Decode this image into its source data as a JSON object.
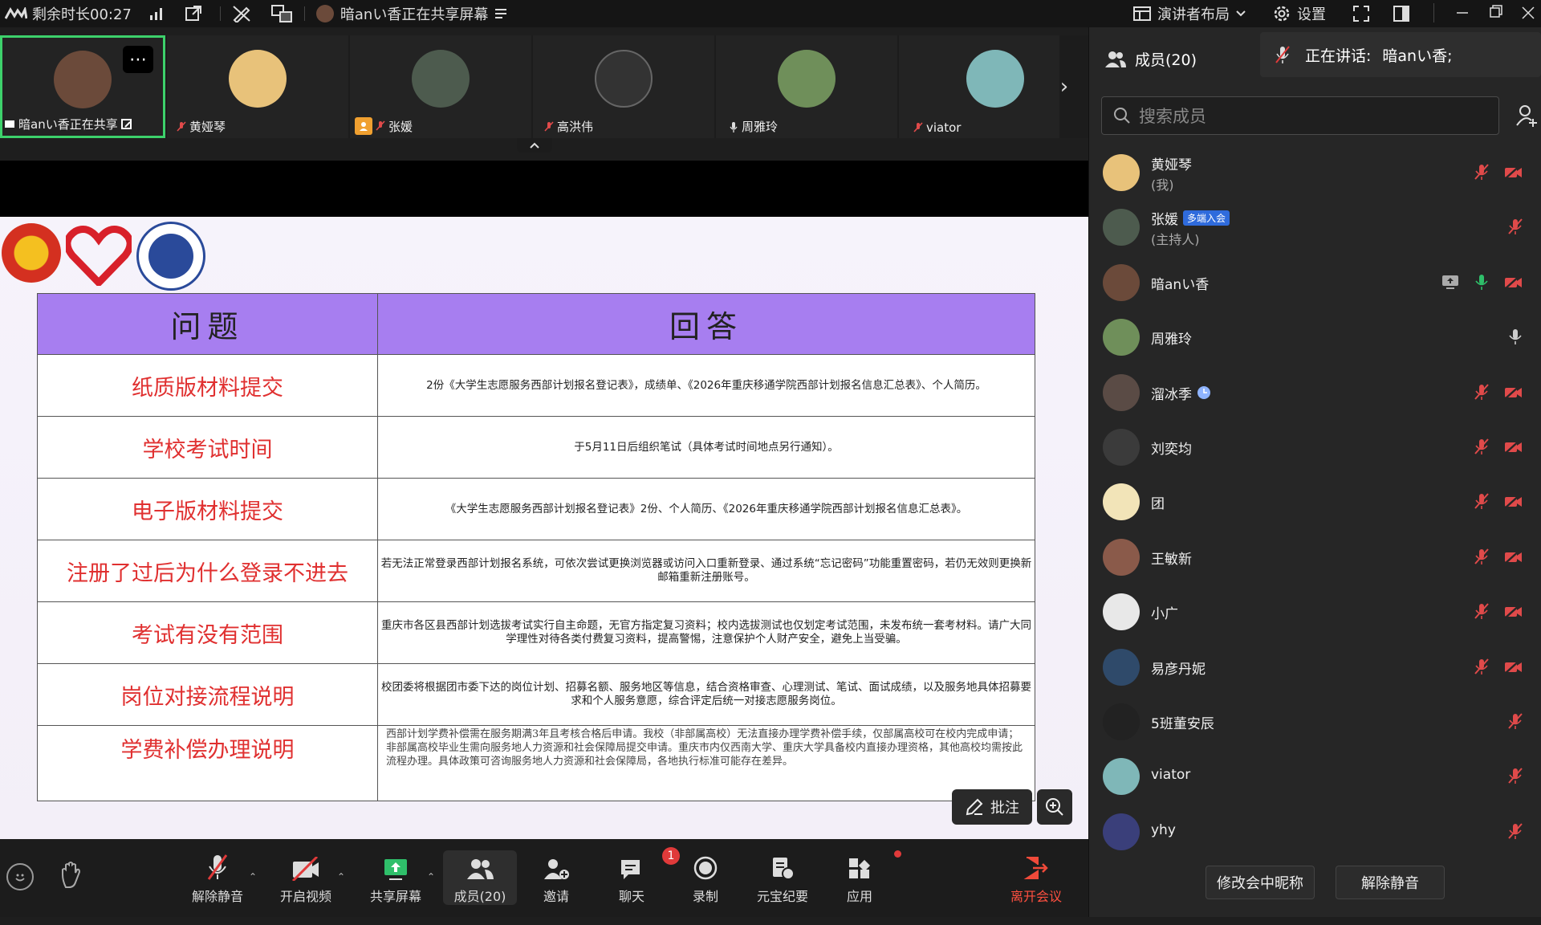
{
  "topbar": {
    "remaining_time": "剩余时长00:27",
    "sharing_notice": "暗anい香正在共享屏幕",
    "layout_label": "演讲者布局",
    "settings_label": "设置"
  },
  "strip": {
    "tiles": [
      {
        "name": "暗anい香正在共享",
        "avatar_color": "#6b4a3a"
      },
      {
        "name": "黄娅琴",
        "avatar_color": "#e8c27a"
      },
      {
        "name": "张媛",
        "avatar_color": "#4d5b4e"
      },
      {
        "name": "高洪伟",
        "avatar_color": "#333333"
      },
      {
        "name": "周雅玲",
        "avatar_color": "#6f8f5a"
      },
      {
        "name": "viator",
        "avatar_color": "#7fb7b8"
      }
    ]
  },
  "slide": {
    "header_question": "问题",
    "header_answer": "回答",
    "rows": [
      {
        "q": "纸质版材料提交",
        "a": "2份《大学生志愿服务西部计划报名登记表》，成绩单、《2026年重庆移通学院西部计划报名信息汇总表》、个人简历。"
      },
      {
        "q": "学校考试时间",
        "a": "于5月11日后组织笔试（具体考试时间地点另行通知）。"
      },
      {
        "q": "电子版材料提交",
        "a": "《大学生志愿服务西部计划报名登记表》2份、个人简历、《2026年重庆移通学院西部计划报名信息汇总表》。"
      },
      {
        "q": "注册了过后为什么登录不进去",
        "a": "若无法正常登录西部计划报名系统，可依次尝试更换浏览器或访问入口重新登录、通过系统“忘记密码”功能重置密码，若仍无效则更换新邮箱重新注册账号。"
      },
      {
        "q": "考试有没有范围",
        "a": "重庆市各区县西部计划选拔考试实行自主命题，无官方指定复习资料；校内选拔测试也仅划定考试范围，未发布统一套考材料。请广大同学理性对待各类付费复习资料，提高警惕，注意保护个人财产安全，避免上当受骗。"
      },
      {
        "q": "岗位对接流程说明",
        "a": "校团委将根据团市委下达的岗位计划、招募名额、服务地区等信息，结合资格审查、心理测试、笔试、面试成绩，以及服务地具体招募要求和个人服务意愿，综合评定后统一对接志愿服务岗位。"
      },
      {
        "q": "学费补偿办理说明",
        "a": "西部计划学费补偿需在服务期满3年且考核合格后申请。我校（非部属高校）无法直接办理学费补偿手续，仅部属高校可在校内完成申请；非部属高校毕业生需向服务地人力资源和社会保障局提交申请。重庆市内仅西南大学、重庆大学具备校内直接办理资格，其他高校均需按此流程办理。具体政策可咨询服务地人力资源和社会保障局，各地执行标准可能存在差异。"
      }
    ],
    "annotate_label": "批注"
  },
  "toolbar": {
    "unmute": "解除静音",
    "video": "开启视频",
    "share": "共享屏幕",
    "members": "成员(20)",
    "invite": "邀请",
    "chat": "聊天",
    "chat_badge": "1",
    "record": "录制",
    "summary": "元宝纪要",
    "apps": "应用",
    "leave": "离开会议"
  },
  "panel": {
    "title": "成员(20)",
    "speaking_label": "正在讲话:",
    "speaking_name": "暗anい香;",
    "search_placeholder": "搜索成员",
    "members": [
      {
        "name": "黄娅琴",
        "role": "(我)",
        "color": "#e8c27a",
        "icons": [
          "mic-off",
          "cam-off"
        ]
      },
      {
        "name": "张媛",
        "role": "(主持人)",
        "badge": "多端入会",
        "color": "#4d5b4e",
        "icons": [
          "mic-off"
        ]
      },
      {
        "name": "暗anい香",
        "color": "#6b4a3a",
        "icons": [
          "share",
          "mic-on",
          "cam-off"
        ]
      },
      {
        "name": "周雅玲",
        "color": "#6f8f5a",
        "icons": [
          "mic-gray"
        ]
      },
      {
        "name": "溜冰季",
        "color": "#5a4b45",
        "clock": true,
        "icons": [
          "mic-off",
          "cam-off"
        ]
      },
      {
        "name": "刘奕均",
        "color": "#3b3b3b",
        "icons": [
          "mic-off",
          "cam-off"
        ]
      },
      {
        "name": "团",
        "color": "#f2e4b8",
        "icons": [
          "mic-off",
          "cam-off"
        ]
      },
      {
        "name": "王敏新",
        "color": "#8a5a4a",
        "icons": [
          "mic-off",
          "cam-off"
        ]
      },
      {
        "name": "小广",
        "color": "#e8e8e8",
        "icons": [
          "mic-off",
          "cam-off"
        ]
      },
      {
        "name": "易彦丹妮",
        "color": "#2f4a6a",
        "icons": [
          "mic-off",
          "cam-off"
        ]
      },
      {
        "name": "5班董安辰",
        "color": "#222222",
        "icons": [
          "mic-off"
        ]
      },
      {
        "name": "viator",
        "color": "#7fb7b8",
        "icons": [
          "mic-off"
        ]
      },
      {
        "name": "yhy",
        "color": "#3a3f7a",
        "icons": [
          "mic-off"
        ]
      }
    ],
    "rename_button": "修改会中昵称",
    "unmute_button": "解除静音"
  }
}
